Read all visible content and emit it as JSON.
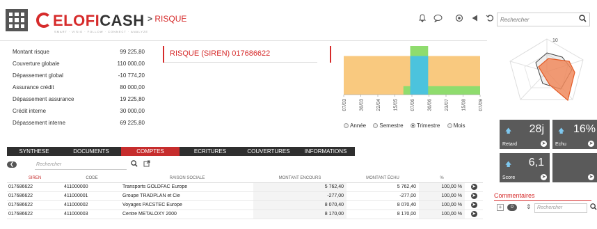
{
  "header": {
    "logo_brand": "CELOFICASH",
    "logo_tagline": "SMART · VISIO · FOLLOW · CONNECT · ANALYZE",
    "breadcrumb_current": "RISQUE",
    "search_placeholder": "Rechercher",
    "icons": [
      "bell-icon",
      "chat-icon",
      "target-icon",
      "back-icon",
      "undo-icon",
      "search-icon"
    ]
  },
  "metrics": [
    {
      "label": "Montant risque",
      "value": "99 225,80"
    },
    {
      "label": "Couverture globale",
      "value": "110 000,00"
    },
    {
      "label": "Dépassement global",
      "value": "-10 774,20"
    },
    {
      "label": "Assurance crédit",
      "value": "80 000,00"
    },
    {
      "label": "Dépassement assurance",
      "value": "19 225,80"
    },
    {
      "label": "Crédit interne",
      "value": "30 000,00"
    },
    {
      "label": "Dépassement interne",
      "value": "69 225,80"
    }
  ],
  "risk_title": "RISQUE (SIREN) 017686622",
  "chart_data": {
    "type": "area",
    "title": "",
    "categories": [
      "07/03",
      "30/03",
      "22/04",
      "15/05",
      "07/06",
      "30/06",
      "23/07",
      "15/08",
      "07/09"
    ],
    "series": [
      {
        "values": [
          100,
          100,
          100,
          100,
          100,
          100,
          100,
          100,
          100
        ],
        "color": "#f9c97f"
      },
      {
        "values": [
          0,
          0,
          0,
          0,
          22,
          22,
          22,
          22,
          0
        ],
        "color": "#8fdc6e"
      },
      {
        "values": [
          0,
          0,
          0,
          0,
          100,
          0,
          0,
          0,
          0
        ],
        "color": "#4cc3dd"
      },
      {
        "values": [
          0,
          0,
          0,
          0,
          126,
          0,
          0,
          0,
          0
        ],
        "color": "#8fdc6e"
      }
    ],
    "xlabel": "",
    "ylabel": "",
    "legend": "none"
  },
  "period_options": [
    {
      "label": "Année",
      "selected": false
    },
    {
      "label": "Semestre",
      "selected": false
    },
    {
      "label": "Trimestre",
      "selected": true
    },
    {
      "label": "Mois",
      "selected": false
    }
  ],
  "radar": {
    "scale_label": "10",
    "fill_color": "#f08a5d",
    "stroke_color": "#e35a25"
  },
  "tiles": [
    {
      "value": "28j",
      "caption": "Retard",
      "arrow": true
    },
    {
      "value": "16%",
      "caption": "Echu",
      "arrow": true
    },
    {
      "value": "6,1",
      "caption": "Score",
      "arrow": true
    },
    {
      "value": "",
      "caption": "",
      "arrow": false
    }
  ],
  "comments": {
    "title": "Commentaires",
    "count": "0",
    "search_placeholder": "Rechercher"
  },
  "tabs": [
    {
      "label": "SYNTHESE",
      "active": false
    },
    {
      "label": "DOCUMENTS",
      "active": false
    },
    {
      "label": "COMPTES",
      "active": true
    },
    {
      "label": "ECRITURES",
      "active": false
    },
    {
      "label": "COUVERTURES",
      "active": false
    },
    {
      "label": "INFORMATIONS",
      "active": false
    }
  ],
  "table": {
    "search_placeholder": "Rechercher",
    "columns": [
      "SIREN",
      "CODE",
      "RAISON SOCIALE",
      "MONTANT ENCOURS",
      "MONTANT ÉCHU",
      "%"
    ],
    "rows": [
      {
        "siren": "017686622",
        "code": "411000000",
        "name": "Transports GOLDFAC Europe",
        "encours": "5 762,40",
        "echu": "5 762,40",
        "pct": "100,00 %"
      },
      {
        "siren": "017686622",
        "code": "411000001",
        "name": "Groupe TRADPLAN et Cie",
        "encours": "-277,00",
        "echu": "-277,00",
        "pct": "100,00 %"
      },
      {
        "siren": "017686622",
        "code": "411000002",
        "name": "Voyages PACSTEC Europe",
        "encours": "8 070,40",
        "echu": "8 070,40",
        "pct": "100,00 %"
      },
      {
        "siren": "017686622",
        "code": "411000003",
        "name": "Centre METALOXY 2000",
        "encours": "8 170,00",
        "echu": "8 170,00",
        "pct": "100,00 %"
      }
    ]
  }
}
